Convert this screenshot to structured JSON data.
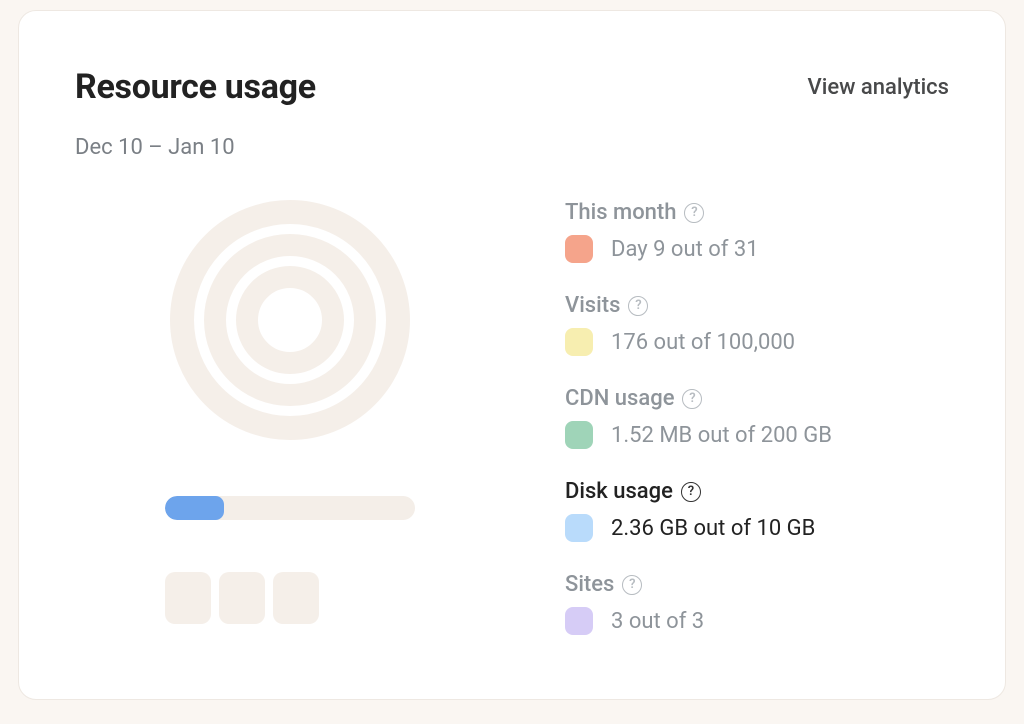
{
  "header": {
    "title": "Resource usage",
    "view_analytics": "View analytics",
    "date_range": "Dec 10 – Jan 10"
  },
  "disk_usage_fill_percent": 23.6,
  "metrics": [
    {
      "key": "month",
      "label": "This month",
      "value": "Day 9 out of 31",
      "swatch": "#f5a48b",
      "active": false
    },
    {
      "key": "visits",
      "label": "Visits",
      "value": "176 out of 100,000",
      "swatch": "#f7eeb0",
      "active": false
    },
    {
      "key": "cdn",
      "label": "CDN usage",
      "value": "1.52 MB out of 200 GB",
      "swatch": "#9fd4b8",
      "active": false
    },
    {
      "key": "disk",
      "label": "Disk usage",
      "value": "2.36 GB out of 10 GB",
      "swatch": "#b9dbfb",
      "active": true
    },
    {
      "key": "sites",
      "label": "Sites",
      "value": "3 out of 3",
      "swatch": "#d6ccf6",
      "active": false
    }
  ],
  "chart_data": [
    {
      "type": "pie",
      "title": "Resource usage radial",
      "note": "concentric rings placeholder, proportions not labeled"
    },
    {
      "type": "bar",
      "title": "Disk usage",
      "categories": [
        "Disk"
      ],
      "values": [
        2.36
      ],
      "ylim": [
        0,
        10
      ],
      "unit": "GB"
    },
    {
      "type": "bar",
      "title": "Sites",
      "categories": [
        "Sites"
      ],
      "values": [
        3
      ],
      "ylim": [
        0,
        3
      ]
    }
  ]
}
